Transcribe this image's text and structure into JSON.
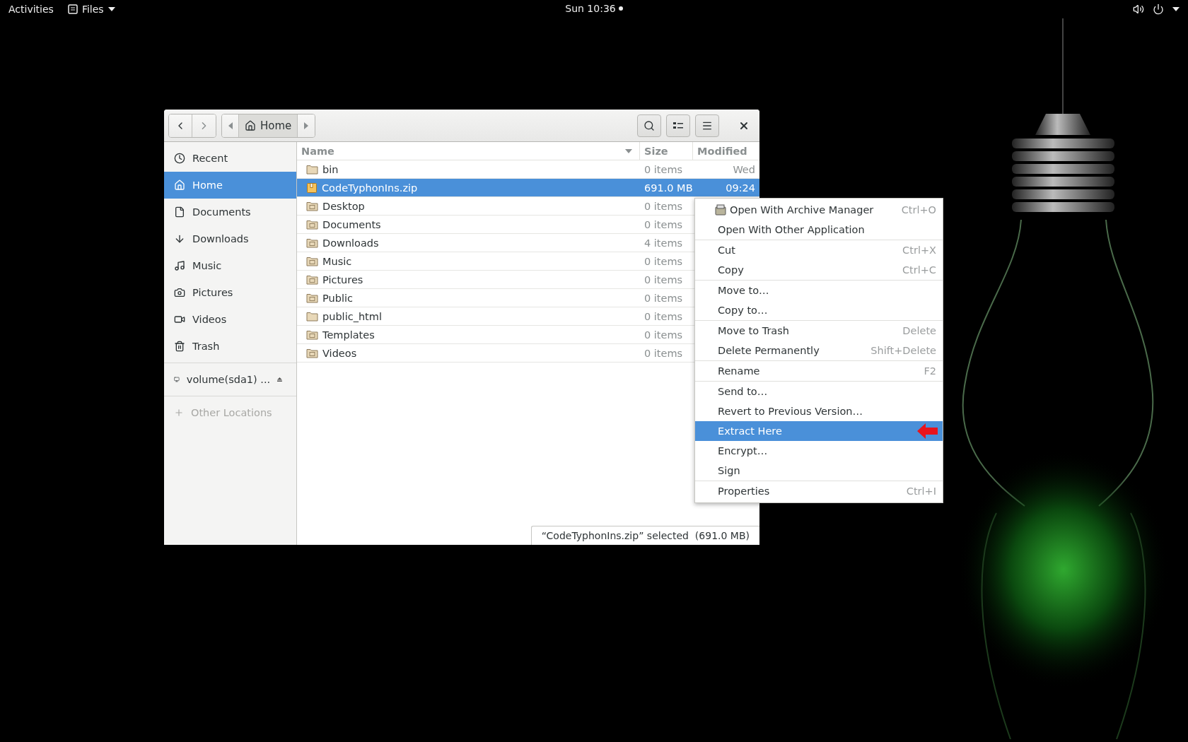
{
  "top_bar": {
    "activities": "Activities",
    "app_menu": "Files",
    "clock": "Sun 10:36"
  },
  "window": {
    "path_bar": {
      "current": "Home"
    },
    "sidebar": {
      "places": [
        {
          "label": "Recent",
          "selected": false
        },
        {
          "label": "Home",
          "selected": true
        },
        {
          "label": "Documents",
          "selected": false
        },
        {
          "label": "Downloads",
          "selected": false
        },
        {
          "label": "Music",
          "selected": false
        },
        {
          "label": "Pictures",
          "selected": false
        },
        {
          "label": "Videos",
          "selected": false
        },
        {
          "label": "Trash",
          "selected": false
        }
      ],
      "devices": [
        {
          "label": "volume(sda1) ..."
        }
      ],
      "other_locations": "Other Locations"
    },
    "file_list": {
      "columns": [
        "Name",
        "Size",
        "Modified"
      ],
      "rows": [
        {
          "kind": "folder",
          "name": "bin",
          "size": "0 items",
          "modified": "Wed",
          "selected": false
        },
        {
          "kind": "archive",
          "name": "CodeTyphonIns.zip",
          "size": "691.0 MB",
          "modified": "09:24",
          "selected": true
        },
        {
          "kind": "folder",
          "name": "Desktop",
          "size": "0 items",
          "selected": false
        },
        {
          "kind": "folder",
          "name": "Documents",
          "size": "0 items",
          "selected": false
        },
        {
          "kind": "folder",
          "name": "Downloads",
          "size": "4 items",
          "selected": false
        },
        {
          "kind": "folder",
          "name": "Music",
          "size": "0 items",
          "selected": false
        },
        {
          "kind": "folder",
          "name": "Pictures",
          "size": "0 items",
          "selected": false
        },
        {
          "kind": "folder",
          "name": "Public",
          "size": "0 items",
          "selected": false
        },
        {
          "kind": "folder",
          "name": "public_html",
          "size": "0 items",
          "selected": false
        },
        {
          "kind": "folder",
          "name": "Templates",
          "size": "0 items",
          "selected": false
        },
        {
          "kind": "folder",
          "name": "Videos",
          "size": "0 items",
          "selected": false
        }
      ]
    },
    "status": "“CodeTyphonIns.zip” selected  (691.0 MB)"
  },
  "context_menu": {
    "groups": [
      [
        {
          "kind": "app",
          "label": "Open With Archive Manager",
          "shortcut": "Ctrl+O",
          "selected": false
        },
        {
          "kind": "action",
          "label": "Open With Other Application",
          "selected": false
        }
      ],
      [
        {
          "kind": "action",
          "label": "Cut",
          "shortcut": "Ctrl+X",
          "selected": false
        },
        {
          "kind": "action",
          "label": "Copy",
          "shortcut": "Ctrl+C",
          "selected": false
        }
      ],
      [
        {
          "kind": "action",
          "label": "Move to…",
          "selected": false
        },
        {
          "kind": "action",
          "label": "Copy to…",
          "selected": false
        }
      ],
      [
        {
          "kind": "action",
          "label": "Move to Trash",
          "shortcut": "Delete",
          "selected": false
        },
        {
          "kind": "action",
          "label": "Delete Permanently",
          "shortcut": "Shift+Delete",
          "selected": false
        }
      ],
      [
        {
          "kind": "action",
          "label": "Rename",
          "shortcut": "F2",
          "selected": false
        }
      ],
      [
        {
          "kind": "action",
          "label": "Send to…",
          "selected": false
        },
        {
          "kind": "action",
          "label": "Revert to Previous Version…",
          "selected": false
        },
        {
          "kind": "action",
          "label": "Extract Here",
          "selected": true,
          "pointer": true
        },
        {
          "kind": "action",
          "label": "Encrypt…",
          "selected": false
        },
        {
          "kind": "action",
          "label": "Sign",
          "selected": false
        }
      ],
      [
        {
          "kind": "action",
          "label": "Properties",
          "shortcut": "Ctrl+I",
          "selected": false
        }
      ]
    ]
  }
}
